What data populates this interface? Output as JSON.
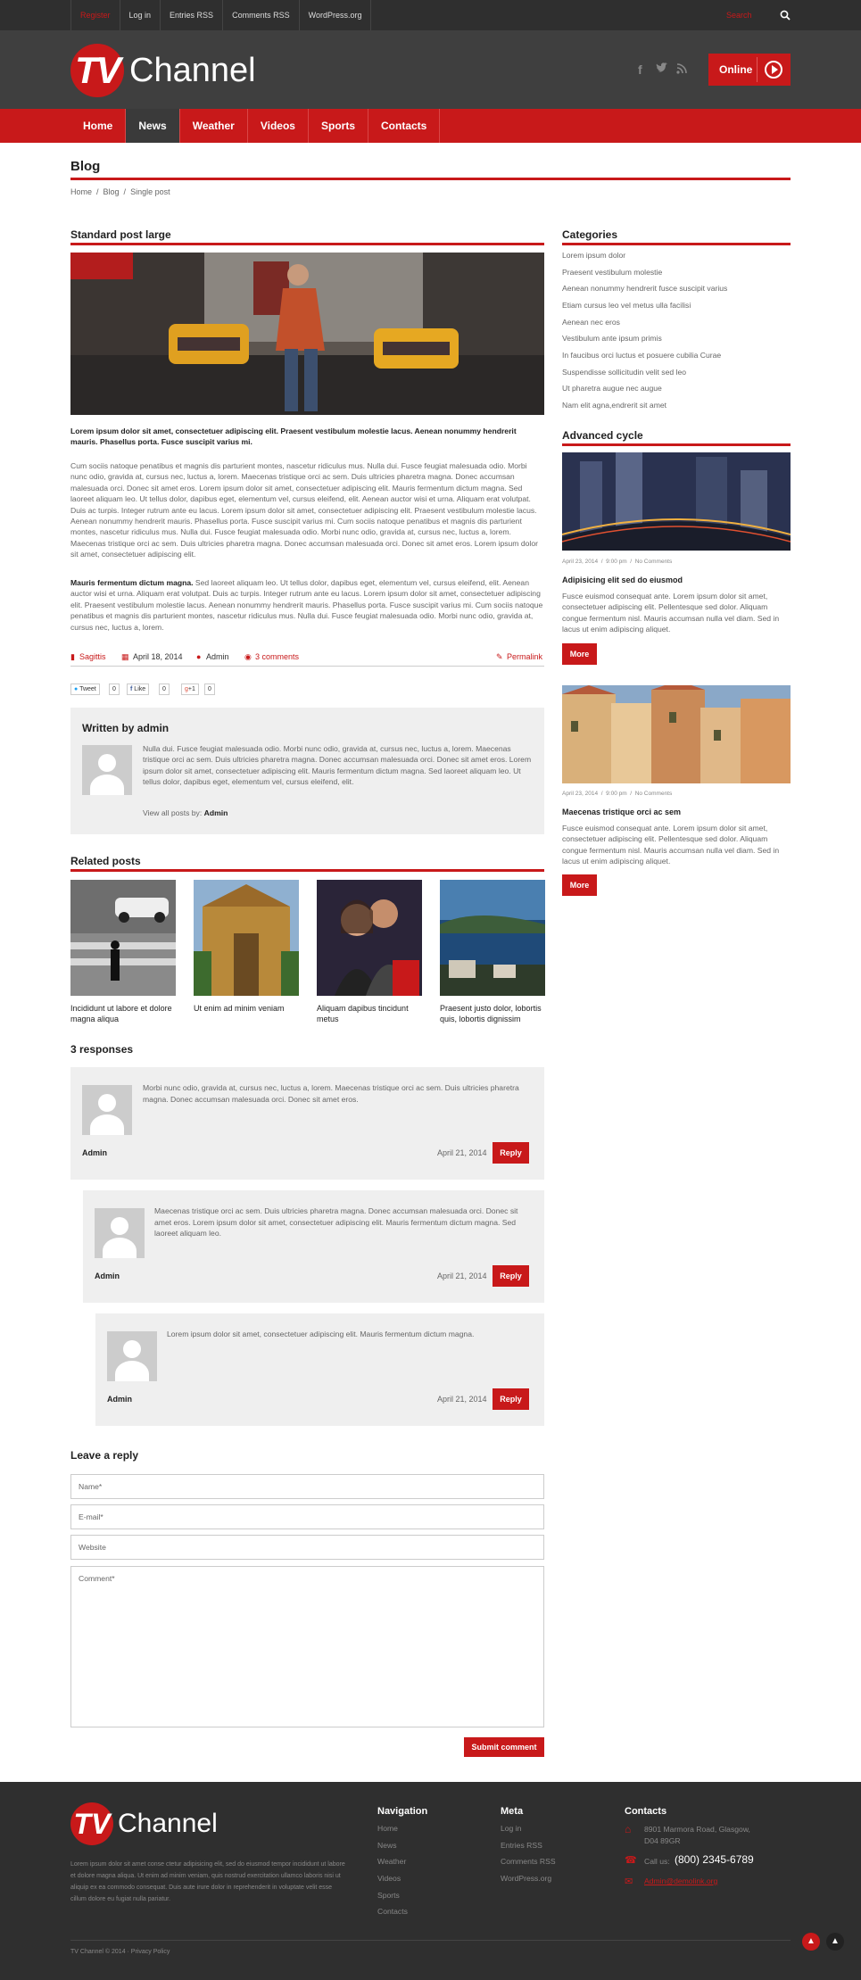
{
  "topbar": {
    "links": [
      "Register",
      "Log in",
      "Entries RSS",
      "Comments RSS",
      "WordPress.org"
    ],
    "search_placeholder": "Search"
  },
  "header": {
    "logo_badge": "TV",
    "logo_word": "Channel",
    "online_label": "Online"
  },
  "nav": [
    "Home",
    "News",
    "Weather",
    "Videos",
    "Sports",
    "Contacts"
  ],
  "page": {
    "title": "Blog",
    "breadcrumb": [
      "Home",
      "Blog",
      "Single post"
    ]
  },
  "post": {
    "heading": "Standard post large",
    "lead": "Lorem ipsum dolor sit amet, consectetuer adipiscing elit. Praesent vestibulum molestie lacus. Aenean nonummy hendrerit mauris. Phasellus porta. Fusce suscipit varius mi.",
    "body1": "Cum sociis natoque penatibus et magnis dis parturient montes, nascetur ridiculus mus. Nulla dui. Fusce feugiat malesuada odio. Morbi nunc odio, gravida at, cursus nec, luctus a, lorem. Maecenas tristique orci ac sem. Duis ultricies pharetra magna. Donec accumsan malesuada orci. Donec sit amet eros. Lorem ipsum dolor sit amet, consectetuer adipiscing elit. Mauris fermentum dictum magna. Sed laoreet aliquam leo. Ut tellus dolor, dapibus eget, elementum vel, cursus eleifend, elit. Aenean auctor wisi et urna. Aliquam erat volutpat. Duis ac turpis. Integer rutrum ante eu lacus. Lorem ipsum dolor sit amet, consectetuer adipiscing elit. Praesent vestibulum molestie lacus. Aenean nonummy hendrerit mauris. Phasellus porta. Fusce suscipit varius mi. Cum sociis natoque penatibus et magnis dis parturient montes, nascetur ridiculus mus. Nulla dui. Fusce feugiat malesuada odio. Morbi nunc odio, gravida at, cursus nec, luctus a, lorem. Maecenas tristique orci ac sem. Duis ultricies pharetra magna. Donec accumsan malesuada orci. Donec sit amet eros. Lorem ipsum dolor sit amet, consectetuer adipiscing elit.",
    "body2_bold": "Mauris fermentum dictum magna.",
    "body2": " Sed laoreet aliquam leo. Ut tellus dolor, dapibus eget, elementum vel, cursus eleifend, elit. Aenean auctor wisi et urna. Aliquam erat volutpat. Duis ac turpis. Integer rutrum ante eu lacus. Lorem ipsum dolor sit amet, consectetuer adipiscing elit. Praesent vestibulum molestie lacus. Aenean nonummy hendrerit mauris. Phasellus porta. Fusce suscipit varius mi. Cum sociis natoque penatibus et magnis dis parturient montes, nascetur ridiculus mus. Nulla dui. Fusce feugiat malesuada odio. Morbi nunc odio, gravida at, cursus nec, luctus a, lorem.",
    "category": "Sagittis",
    "date": "April 18, 2014",
    "author": "Admin",
    "comments": "3 comments",
    "permalink": "Permalink"
  },
  "share": {
    "tweet": "Tweet",
    "tweet_count": "0",
    "like": "Like",
    "like_count": "0",
    "plus": "+1",
    "plus_count": "0"
  },
  "author_box": {
    "heading": "Written by admin",
    "bio": "Nulla dui. Fusce feugiat malesuada odio. Morbi nunc odio, gravida at, cursus nec, luctus a, lorem. Maecenas tristique orci ac sem. Duis ultricies pharetra magna. Donec accumsan malesuada orci. Donec sit amet eros. Lorem ipsum dolor sit amet, consectetuer adipiscing elit. Mauris fermentum dictum magna. Sed laoreet aliquam leo. Ut tellus dolor, dapibus eget, elementum vel, cursus eleifend, elit.",
    "view_all": "View all posts by:",
    "view_all_name": "Admin"
  },
  "related": {
    "heading": "Related posts",
    "items": [
      "Incididunt ut labore et dolore magna aliqua",
      "Ut enim ad minim veniam",
      "Aliquam dapibus tincidunt metus",
      "Praesent justo dolor, lobortis quis, lobortis dignissim"
    ]
  },
  "responses": {
    "heading": "3 responses",
    "items": [
      {
        "text": "Morbi nunc odio, gravida at, cursus nec, luctus a, lorem. Maecenas tristique orci ac sem. Duis ultricies pharetra magna. Donec accumsan malesuada orci. Donec sit amet eros.",
        "author": "Admin",
        "date": "April 21, 2014",
        "reply": "Reply"
      },
      {
        "text": "Maecenas tristique orci ac sem. Duis ultricies pharetra magna. Donec accumsan malesuada orci. Donec sit amet eros. Lorem ipsum dolor sit amet, consectetuer adipiscing elit. Mauris fermentum dictum magna. Sed laoreet aliquam leo.",
        "author": "Admin",
        "date": "April 21, 2014",
        "reply": "Reply"
      },
      {
        "text": "Lorem ipsum dolor sit amet, consectetuer adipiscing elit. Mauris fermentum dictum magna.",
        "author": "Admin",
        "date": "April 21, 2014",
        "reply": "Reply"
      }
    ]
  },
  "reply_form": {
    "heading": "Leave a reply",
    "name": "Name*",
    "email": "E-mail*",
    "website": "Website",
    "comment": "Comment*",
    "submit": "Submit comment"
  },
  "sidebar": {
    "categories_heading": "Categories",
    "categories": [
      "Lorem ipsum dolor",
      "Praesent vestibulum molestie",
      "Aenean nonummy hendrerit fusce suscipit varius",
      "Etiam cursus leo vel metus ulla facilisi",
      "Aenean nec eros",
      "Vestibulum ante ipsum primis",
      "In faucibus orci luctus et posuere cubilia Curae",
      "Suspendisse sollicitudin velit sed leo",
      "Ut pharetra augue nec augue",
      "Nam elit agna,endrerit sit amet"
    ],
    "cycle_heading": "Advanced cycle",
    "cycle": [
      {
        "date": "April 23, 2014",
        "time": "9:00 pm",
        "comments": "No Comments",
        "title": "Adipisicing elit sed do eiusmod",
        "text": "Fusce euismod consequat ante. Lorem ipsum dolor sit amet, consectetuer adipiscing elit. Pellentesque sed dolor. Aliquam congue fermentum nisl. Mauris accumsan nulla vel diam. Sed in lacus ut enim adipiscing aliquet.",
        "more": "More"
      },
      {
        "date": "April 23, 2014",
        "time": "9:00 pm",
        "comments": "No Comments",
        "title": "Maecenas tristique orci ac sem",
        "text": "Fusce euismod consequat ante. Lorem ipsum dolor sit amet, consectetuer adipiscing elit. Pellentesque sed dolor. Aliquam congue fermentum nisl. Mauris accumsan nulla vel diam. Sed in lacus ut enim adipiscing aliquet.",
        "more": "More"
      }
    ]
  },
  "footer": {
    "logo_badge": "TV",
    "logo_word": "Channel",
    "about": "Lorem ipsum dolor sit amet conse ctetur adipisicing elit, sed do eiusmod tempor incididunt ut labore et dolore magna aliqua. Ut enim ad minim veniam, quis nostrud exercitation ullamco laboris nisi ut aliquip ex ea commodo consequat. Duis aute irure dolor in reprehenderit in voluptate velit esse cillum dolore eu fugiat nulla pariatur.",
    "nav_heading": "Navigation",
    "nav": [
      "Home",
      "News",
      "Weather",
      "Videos",
      "Sports",
      "Contacts"
    ],
    "meta_heading": "Meta",
    "meta": [
      "Log in",
      "Entries RSS",
      "Comments RSS",
      "WordPress.org"
    ],
    "contacts_heading": "Contacts",
    "address": "8901 Marmora Road, Glasgow, D04 89GR",
    "call_label": "Call us:",
    "phone": "(800) 2345-6789",
    "email": "Admin@demolink.org",
    "copyright": "TV Channel © 2014 · Privacy Policy"
  },
  "colors": {
    "accent": "#c8191a",
    "dark": "#2f2f2f",
    "header": "#3f3f3f"
  }
}
